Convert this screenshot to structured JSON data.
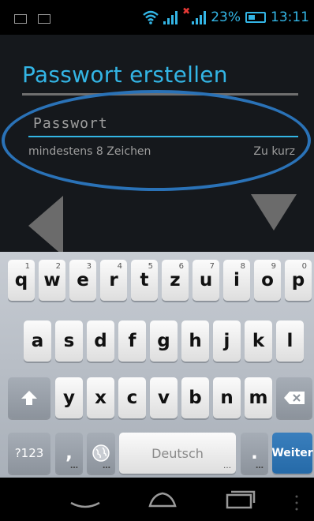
{
  "status_bar": {
    "battery_percent": "23%",
    "time": "13:11",
    "accent_color": "#33b5e5",
    "no_sim_color": "#e53935"
  },
  "screen": {
    "title": "Passwort erstellen",
    "password_placeholder": "Passwort",
    "password_value": "",
    "hint": "mindestens 8 Zeichen",
    "strength_status": "Zu kurz"
  },
  "keyboard": {
    "row1": [
      {
        "key": "q",
        "num": "1"
      },
      {
        "key": "w",
        "num": "2"
      },
      {
        "key": "e",
        "num": "3"
      },
      {
        "key": "r",
        "num": "4"
      },
      {
        "key": "t",
        "num": "5"
      },
      {
        "key": "z",
        "num": "6"
      },
      {
        "key": "u",
        "num": "7"
      },
      {
        "key": "i",
        "num": "8"
      },
      {
        "key": "o",
        "num": "9"
      },
      {
        "key": "p",
        "num": "0"
      }
    ],
    "row2": [
      "a",
      "s",
      "d",
      "f",
      "g",
      "h",
      "j",
      "k",
      "l"
    ],
    "row3": [
      "y",
      "x",
      "c",
      "v",
      "b",
      "n",
      "m"
    ],
    "symbols_label": "?123",
    "comma_label": ",",
    "space_label": "Deutsch",
    "period_label": ".",
    "action_label": "Weiter",
    "action_color": "#2a72b7"
  },
  "icons": {
    "back_arrow": "triangle-left-icon",
    "down_arrow": "triangle-down-icon",
    "shift": "shift-arrow-icon",
    "backspace": "backspace-icon",
    "globe": "globe-icon",
    "nav_back": "back-chevron-icon",
    "nav_home": "home-icon",
    "nav_recent": "recent-apps-icon"
  }
}
